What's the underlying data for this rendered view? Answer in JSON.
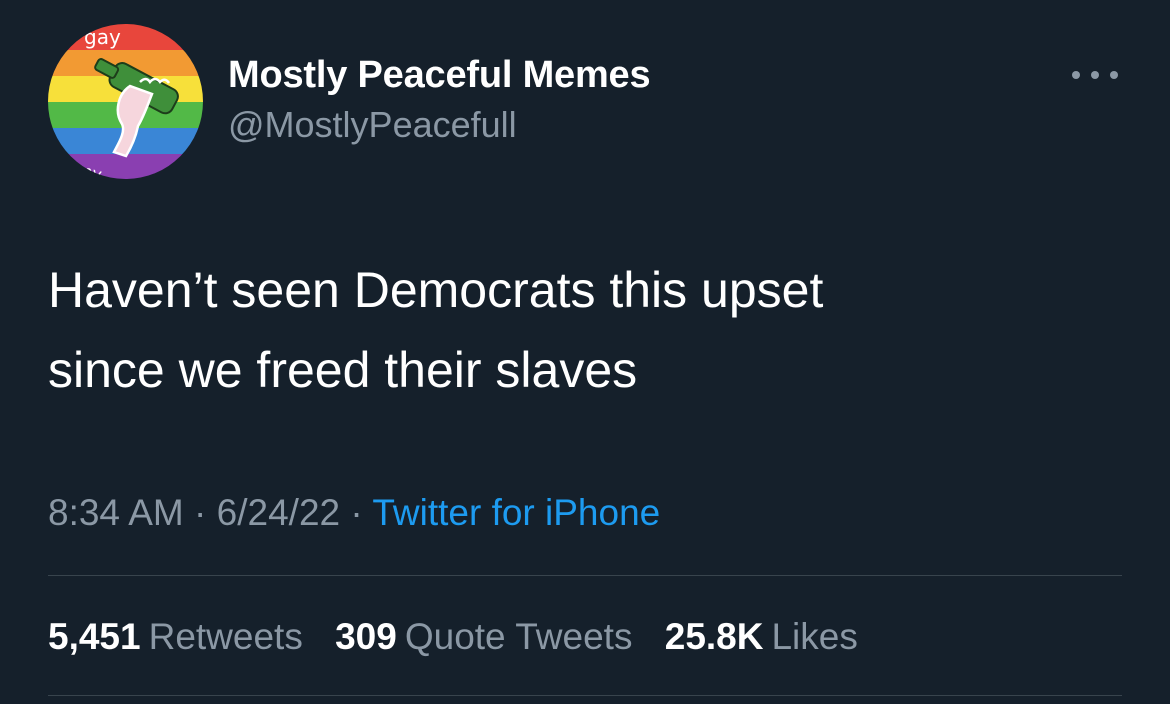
{
  "author": {
    "display_name": "Mostly Peaceful Memes",
    "handle": "@MostlyPeacefull",
    "avatar_icon": "rainbow-hand-bottle-avatar",
    "avatar_texts": [
      "gay",
      "army"
    ]
  },
  "tweet": {
    "text": "Haven’t seen Democrats this upset\nsince we freed their slaves"
  },
  "meta": {
    "time": "8:34 AM",
    "separator": "·",
    "date": "6/24/22",
    "source": "Twitter for iPhone"
  },
  "stats": [
    {
      "value": "5,451",
      "label": "Retweets"
    },
    {
      "value": "309",
      "label": "Quote Tweets"
    },
    {
      "value": "25.8K",
      "label": "Likes"
    }
  ],
  "colors": {
    "background": "#15202b",
    "secondary_text": "#8b98a5",
    "link": "#1d9bf0",
    "divider": "#38444d"
  }
}
